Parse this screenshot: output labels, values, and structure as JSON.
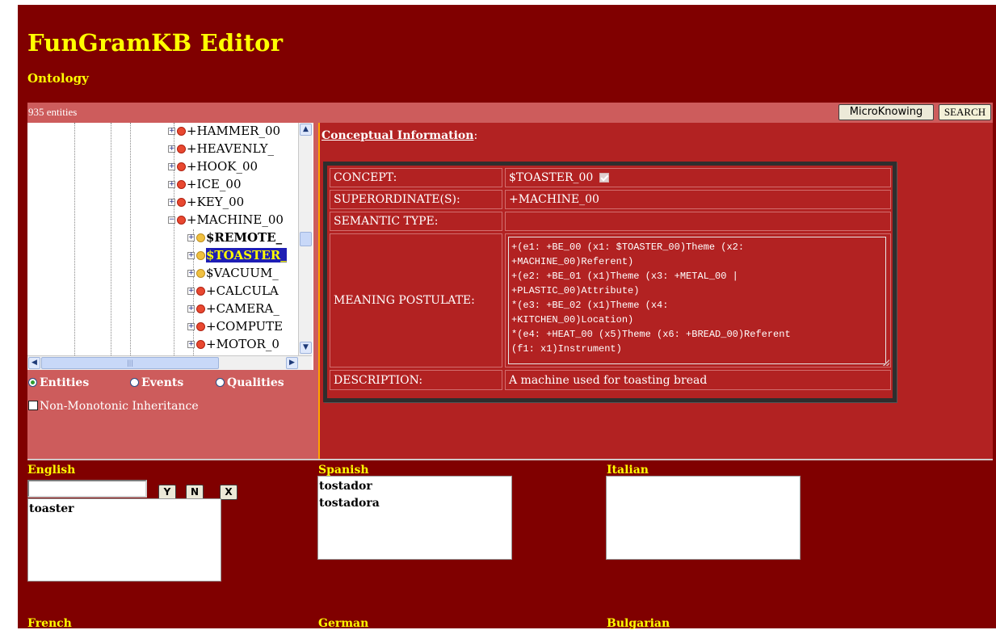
{
  "app": {
    "title": "FunGramKB Editor",
    "subtitle": "Ontology"
  },
  "header": {
    "entity_count": "935 entities",
    "microknowing_label": "MicroKnowing",
    "search_label": "SEARCH"
  },
  "tree": {
    "items": [
      {
        "label": "+HAMMER_00",
        "dot": "red"
      },
      {
        "label": "+HEAVENLY_",
        "dot": "red"
      },
      {
        "label": "+HOOK_00",
        "dot": "red"
      },
      {
        "label": "+ICE_00",
        "dot": "red"
      },
      {
        "label": "+KEY_00",
        "dot": "red"
      },
      {
        "label": "+MACHINE_00",
        "dot": "red"
      },
      {
        "label": "$REMOTE_",
        "dot": "yellow"
      },
      {
        "label": "$TOASTER_",
        "dot": "yellow",
        "selected": true
      },
      {
        "label": "$VACUUM_",
        "dot": "yellow"
      },
      {
        "label": "+CALCULA",
        "dot": "red"
      },
      {
        "label": "+CAMERA_",
        "dot": "red"
      },
      {
        "label": "+COMPUTE",
        "dot": "red"
      },
      {
        "label": "+MOTOR_0",
        "dot": "red"
      }
    ]
  },
  "filters": {
    "entities_label": "Entities",
    "events_label": "Events",
    "qualities_label": "Qualities",
    "selected": "Entities",
    "non_monotonic_label": "Non-Monotonic Inheritance",
    "non_monotonic_checked": false
  },
  "concept_panel": {
    "title": "Conceptual Information",
    "title_suffix": ":",
    "concept_label": "CONCEPT:",
    "concept_value": "$TOASTER_00",
    "concept_checked": true,
    "superordinate_label": "SUPERORDINATE(S):",
    "superordinate_value": "+MACHINE_00",
    "semantic_type_label": "SEMANTIC TYPE:",
    "semantic_type_value": "",
    "meaning_label": "MEANING POSTULATE:",
    "meaning_value": "+(e1: +BE_00 (x1: $TOASTER_00)Theme (x2:\n+MACHINE_00)Referent)\n+(e2: +BE_01 (x1)Theme (x3: +METAL_00 |\n+PLASTIC_00)Attribute)\n*(e3: +BE_02 (x1)Theme (x4:\n+KITCHEN_00)Location)\n*(e4: +HEAT_00 (x5)Theme (x6: +BREAD_00)Referent\n(f1: x1)Instrument)",
    "description_label": "DESCRIPTION:",
    "description_value": "A machine used for toasting bread"
  },
  "languages": {
    "english": {
      "label": "English",
      "input_value": "",
      "y": "Y",
      "n": "N",
      "x": "X",
      "entries": [
        "toaster"
      ]
    },
    "spanish": {
      "label": "Spanish",
      "entries": [
        "tostador",
        "tostadora"
      ]
    },
    "italian": {
      "label": "Italian",
      "entries": []
    },
    "french": {
      "label": "French"
    },
    "german": {
      "label": "German"
    },
    "bulgarian": {
      "label": "Bulgarian"
    }
  },
  "colors": {
    "background": "#800000",
    "accent_text": "#ffff00",
    "header_bar": "#cd5c5c",
    "panel": "#b22222",
    "splitter": "#ffa500",
    "selection": "#1e1eb4"
  }
}
